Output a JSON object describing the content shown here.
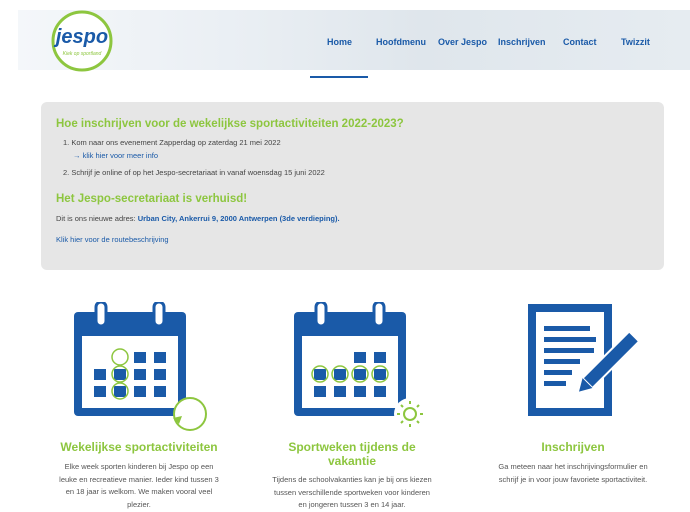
{
  "header": {
    "logo_text": "jespo",
    "logo_tagline": "Kiek op sportland"
  },
  "nav": {
    "items": [
      {
        "label": "Home"
      },
      {
        "label": "Hoofdmenu"
      },
      {
        "label": "Over Jespo"
      },
      {
        "label": "Inschrijven"
      },
      {
        "label": "Contact"
      },
      {
        "label": "Twizzit"
      }
    ],
    "active_index": 0
  },
  "info": {
    "title1": "Hoe inschrijven voor de wekelijkse sportactiviteiten 2022-2023?",
    "step1": "1. Kom naar ons evenement Zapperdag op zaterdag 21 mei 2022",
    "step1_link": "→ klik hier voor meer info",
    "step2": "2. Schrijf je online of op het Jespo-secretariaat in vanaf woensdag 15 juni 2022",
    "title2": "Het Jespo-secretariaat is verhuisd!",
    "address_prefix": "Dit is ons nieuwe adres: ",
    "address": "Urban City, Ankerrui 9, 2000 Antwerpen (3de verdieping).",
    "route_link": "Klik hier voor de routebeschrijving"
  },
  "features": [
    {
      "icon": "calendar-weekly-icon",
      "title": "Wekelijkse sportactiviteiten",
      "lines": [
        "Elke week sporten kinderen bij Jespo op een",
        "leuke en recreatieve manier. Ieder kind tussen 3",
        "en 18 jaar is welkom. We maken vooral veel",
        "plezier."
      ]
    },
    {
      "icon": "calendar-sun-icon",
      "title_lines": [
        "Sportweken tijdens de",
        "vakantie"
      ],
      "lines": [
        "Tijdens de schoolvakanties kan je bij ons kiezen",
        "tussen verschillende sportweken voor kinderen",
        "en jongeren tussen 3 en 14 jaar."
      ]
    },
    {
      "icon": "form-pen-icon",
      "title": "Inschrijven",
      "lines": [
        "Ga meteen naar het inschrijvingsformulier en",
        "schrijf je in voor jouw favoriete sportactiviteit."
      ]
    }
  ],
  "colors": {
    "brand_blue": "#1a5aa8",
    "brand_green": "#8dc63f",
    "box_bg": "#e6e6e6"
  }
}
